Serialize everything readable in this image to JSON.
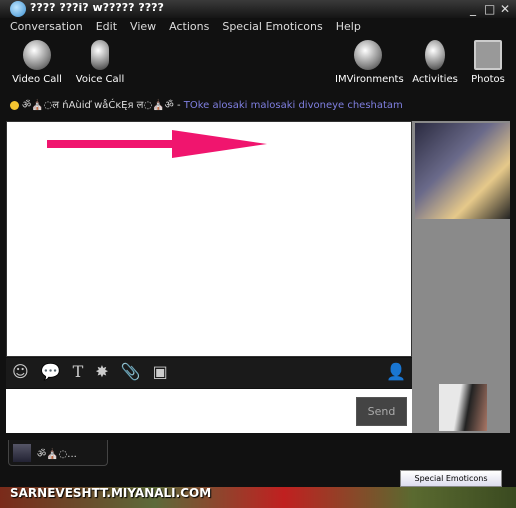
{
  "window": {
    "title": "???? ???i? w????? ????",
    "minimize": "_",
    "maximize": "□",
    "close": "✕"
  },
  "menu": [
    "Conversation",
    "Edit",
    "View",
    "Actions",
    "Special Emoticons",
    "Help"
  ],
  "toolbar": {
    "left": [
      {
        "label": "Video Call",
        "icon": "webcam-icon"
      },
      {
        "label": "Voice Call",
        "icon": "microphone-icon"
      }
    ],
    "right": [
      {
        "label": "IMVironments",
        "icon": "leaves-icon"
      },
      {
        "label": "Activities",
        "icon": "chess-knight-icon"
      },
      {
        "label": "Photos",
        "icon": "photos-icon"
      }
    ]
  },
  "status": {
    "name": "ॐ⛪◌ल ńAùiď wåĆĸĘя ल◌⛪ॐ",
    "separator": "-",
    "message": "TOke alosaki malosaki divoneye cheshatam",
    "dot_color": "#f4c430"
  },
  "annotation": {
    "arrow_color": "#f0156e"
  },
  "editor_tools": [
    "☺",
    "💬",
    "T",
    "✸",
    "📎",
    "▣"
  ],
  "send_label": "Send",
  "tab": {
    "label": "ॐ⛪◌..."
  },
  "special_emoticons_button": "Special Emoticons",
  "watermark": "SARNEVESHTT.MIYANALI.COM"
}
